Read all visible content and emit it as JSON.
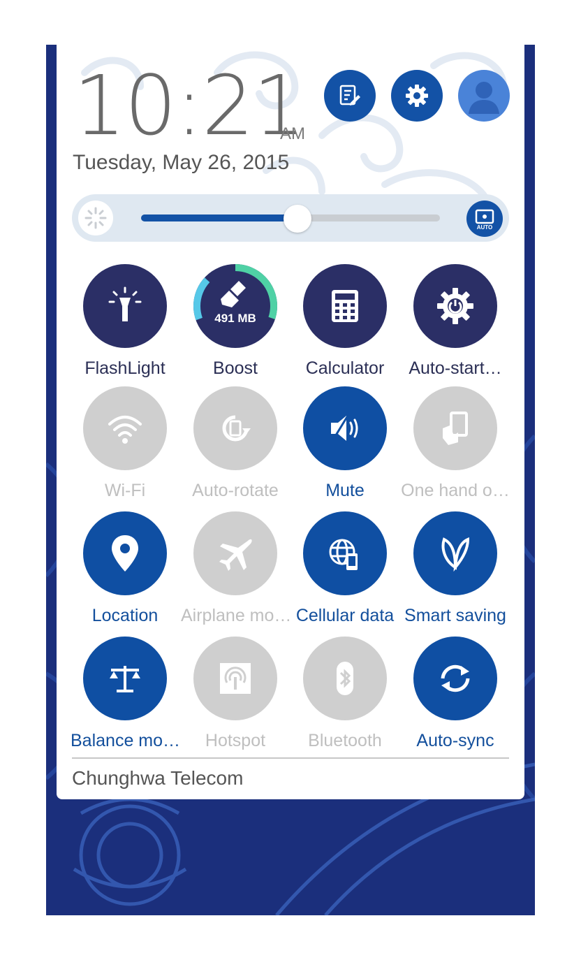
{
  "status": {
    "time": "10:21",
    "ampm": "AM",
    "date": "Tuesday, May 26, 2015"
  },
  "top_buttons": [
    {
      "name": "edit-quick-settings",
      "icon": "edit-list-icon"
    },
    {
      "name": "settings",
      "icon": "gear-icon"
    },
    {
      "name": "user-profile",
      "icon": "avatar-icon"
    }
  ],
  "brightness": {
    "level": 0.5,
    "auto_label": "AUTO"
  },
  "tiles": [
    {
      "label": "FlashLight",
      "state": "dark",
      "icon": "flashlight-icon"
    },
    {
      "label": "Boost",
      "state": "dark",
      "icon": "broom-icon",
      "value": "491 MB",
      "ring_fraction": 0.3
    },
    {
      "label": "Calculator",
      "state": "dark",
      "icon": "calculator-icon"
    },
    {
      "label": "Auto-start…",
      "state": "dark",
      "icon": "gear-power-icon"
    },
    {
      "label": "Wi-Fi",
      "state": "gray",
      "icon": "wifi-icon"
    },
    {
      "label": "Auto-rotate",
      "state": "gray",
      "icon": "rotate-icon"
    },
    {
      "label": "Mute",
      "state": "blue",
      "icon": "mute-speaker-icon"
    },
    {
      "label": "One hand o…",
      "state": "gray",
      "icon": "one-hand-icon"
    },
    {
      "label": "Location",
      "state": "blue",
      "icon": "location-pin-icon"
    },
    {
      "label": "Airplane mo…",
      "state": "gray",
      "icon": "airplane-icon"
    },
    {
      "label": "Cellular data",
      "state": "blue",
      "icon": "globe-phone-icon"
    },
    {
      "label": "Smart saving",
      "state": "blue",
      "icon": "leaf-icon"
    },
    {
      "label": "Balance mo…",
      "state": "blue",
      "icon": "balance-scale-icon"
    },
    {
      "label": "Hotspot",
      "state": "gray",
      "icon": "hotspot-icon"
    },
    {
      "label": "Bluetooth",
      "state": "gray",
      "icon": "bluetooth-icon"
    },
    {
      "label": "Auto-sync",
      "state": "blue",
      "icon": "sync-icon"
    }
  ],
  "carrier": "Chunghwa Telecom",
  "colors": {
    "active": "#0f4fa3",
    "app": "#2b2f66",
    "inactive": "#cfcfcf",
    "wallpaper": "#1b2f7c"
  }
}
